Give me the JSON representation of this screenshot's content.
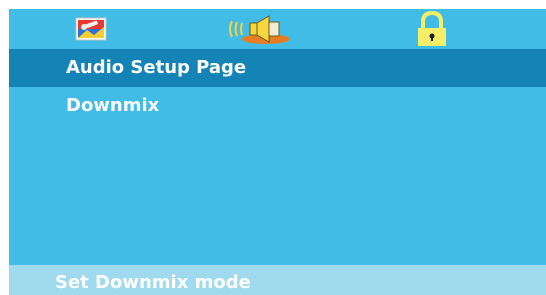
{
  "tabs": [
    {
      "name": "general-setup",
      "icon": "wrench-screen-icon"
    },
    {
      "name": "audio-setup",
      "icon": "speaker-sound-icon",
      "active": true
    },
    {
      "name": "preference-lock",
      "icon": "padlock-icon"
    }
  ],
  "page": {
    "title": "Audio Setup Page"
  },
  "menu": {
    "items": [
      "Downmix"
    ]
  },
  "status": {
    "text": "Set Downmix mode"
  },
  "colors": {
    "background": "#41bce7",
    "title_bar": "#1484b6",
    "status_bar": "#9fdaee",
    "text": "#ffffff"
  }
}
